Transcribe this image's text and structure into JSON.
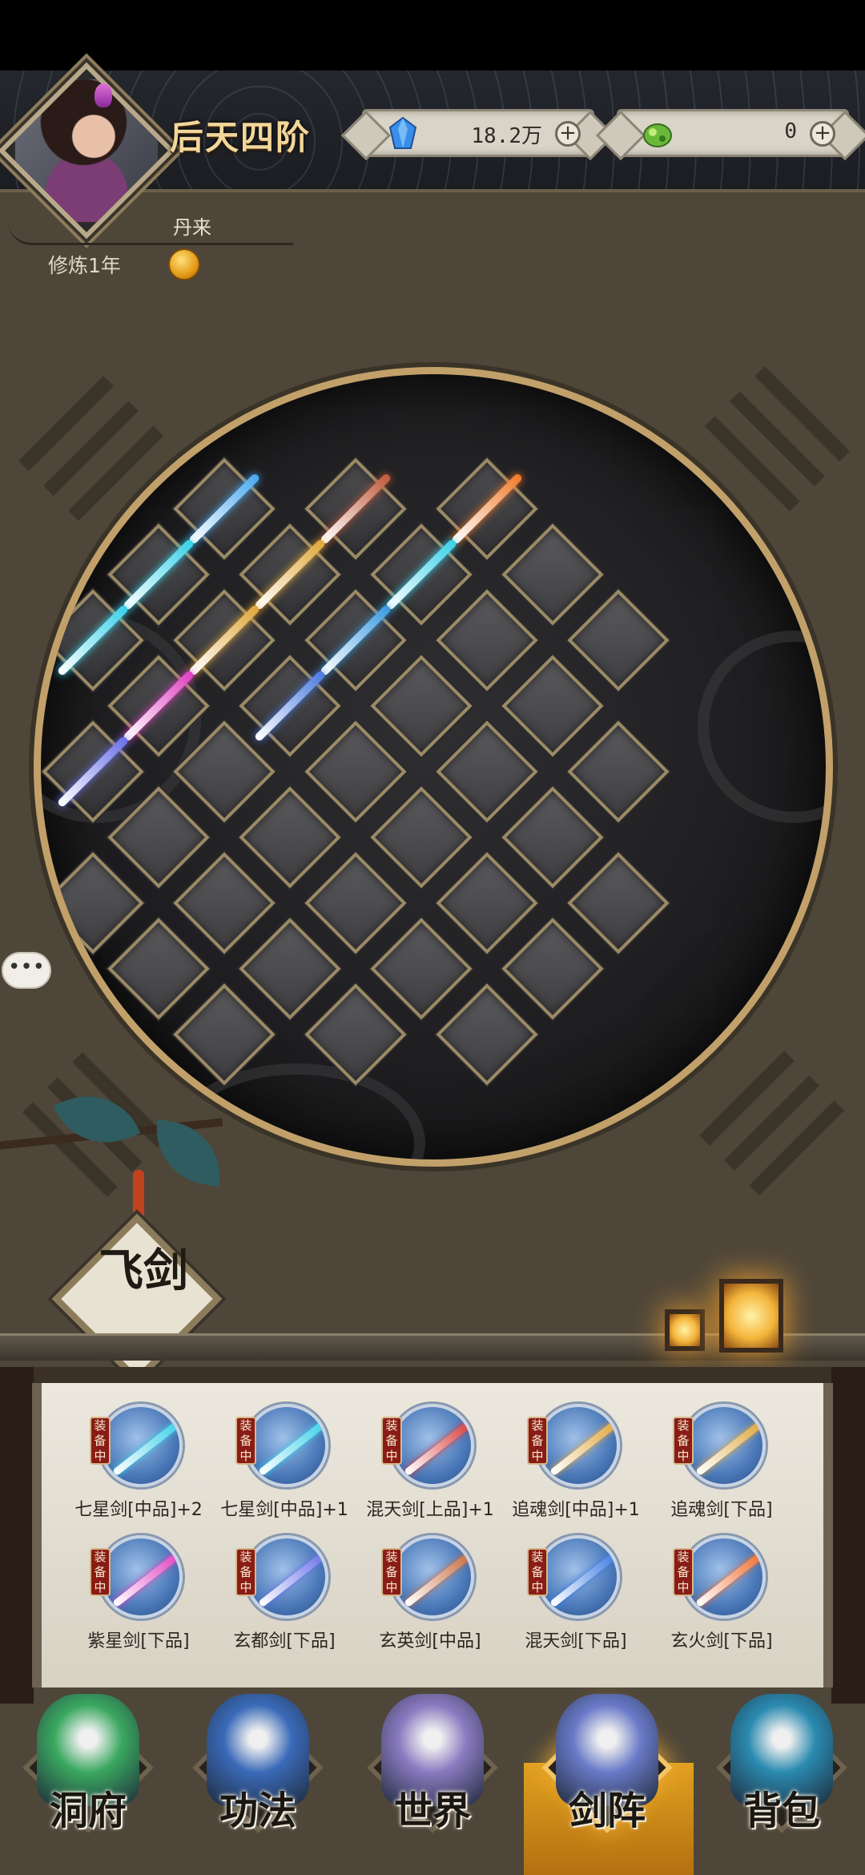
{
  "header": {
    "realm": "后天四阶",
    "character_name": "丹来",
    "cultivation": "修炼1年",
    "spirit_stone": {
      "value": "18.2万",
      "icon": "blue-crystal-icon",
      "plus": "+"
    },
    "jade": {
      "value": "0",
      "icon": "green-jade-icon",
      "plus": "+"
    }
  },
  "arena": {
    "speech": "•••"
  },
  "section_title": "飞剑",
  "inventory": {
    "equip_tag": "装备中",
    "items": [
      {
        "name": "七星剑[中品]+2",
        "color": "#3ad0e8"
      },
      {
        "name": "七星剑[中品]+1",
        "color": "#3ad0e8"
      },
      {
        "name": "混天剑[上品]+1",
        "color": "#d83a3a"
      },
      {
        "name": "追魂剑[中品]+1",
        "color": "#e0a63a"
      },
      {
        "name": "追魂剑[下品]",
        "color": "#e0a63a"
      },
      {
        "name": "紫星剑[下品]",
        "color": "#e040c0"
      },
      {
        "name": "玄都剑[下品]",
        "color": "#6a70e8"
      },
      {
        "name": "玄英剑[中品]",
        "color": "#c86a3a"
      },
      {
        "name": "混天剑[下品]",
        "color": "#3a7ae0"
      },
      {
        "name": "玄火剑[下品]",
        "color": "#f06a2a"
      }
    ]
  },
  "nav": {
    "items": [
      {
        "label": "洞府",
        "icon": "cave-mansion-icon",
        "color": "#3aa860"
      },
      {
        "label": "功法",
        "icon": "technique-book-icon",
        "color": "#3a6ab8"
      },
      {
        "label": "世界",
        "icon": "world-scroll-icon",
        "color": "#8a7ac0"
      },
      {
        "label": "剑阵",
        "icon": "sword-array-icon",
        "color": "#6a7ac8",
        "active": true
      },
      {
        "label": "背包",
        "icon": "backpack-icon",
        "color": "#2a8ab0"
      }
    ]
  },
  "colors": {
    "background": "#4e4639",
    "gold_accent": "#c2a06a",
    "active_tab": "#e0a020"
  }
}
